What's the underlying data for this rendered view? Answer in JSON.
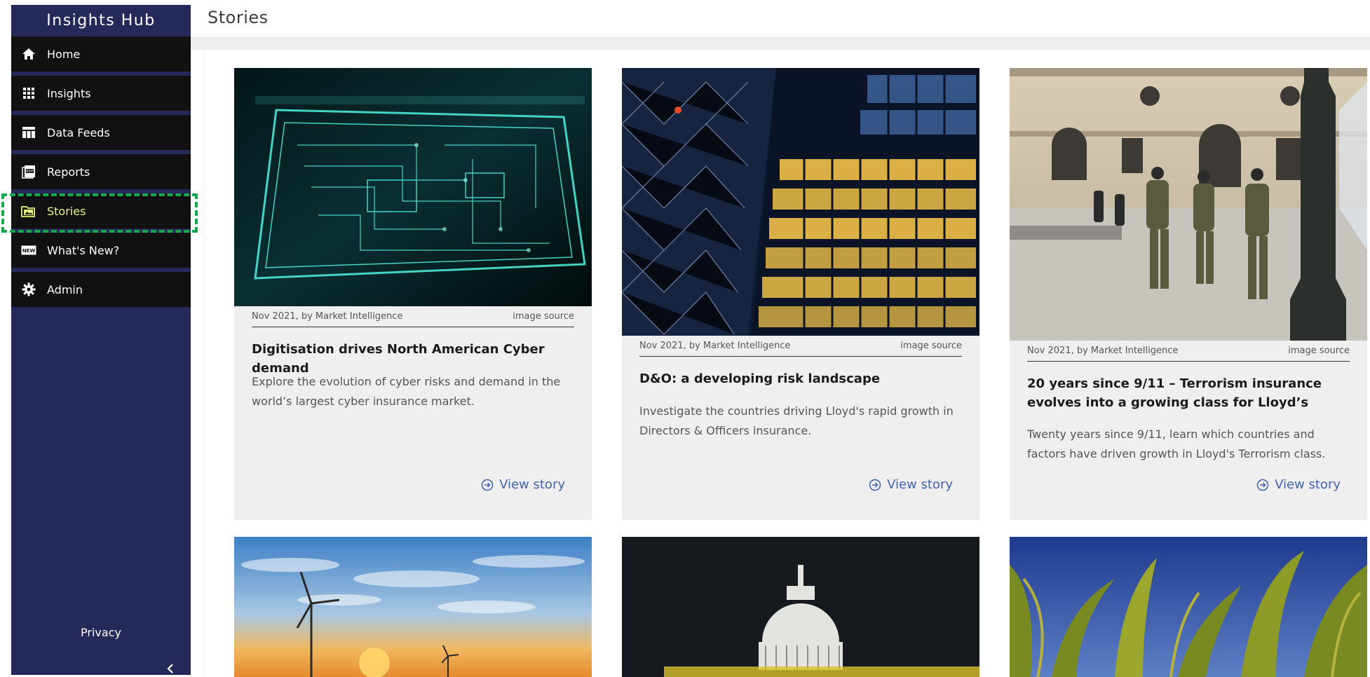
{
  "app": {
    "title": "Insights Hub"
  },
  "page": {
    "title": "Stories"
  },
  "sidebar": {
    "items": [
      {
        "label": "Home",
        "icon": "home-icon"
      },
      {
        "label": "Insights",
        "icon": "grid-icon"
      },
      {
        "label": "Data Feeds",
        "icon": "table-icon"
      },
      {
        "label": "Reports",
        "icon": "pdf-icon"
      },
      {
        "label": "Stories",
        "icon": "stories-icon",
        "active": true
      },
      {
        "label": "What's New?",
        "icon": "new-badge-icon"
      },
      {
        "label": "Admin",
        "icon": "gear-icon"
      }
    ],
    "privacy_label": "Privacy",
    "collapse_icon": "chevron-left-icon"
  },
  "stories": [
    {
      "meta": "Nov 2021, by Market Intelligence",
      "image_source_label": "image source",
      "title": "Digitisation drives North American Cyber demand",
      "description": "Explore the evolution of cyber risks and demand in the world’s largest cyber insurance market.",
      "view_label": "View story"
    },
    {
      "meta": "Nov 2021, by Market Intelligence",
      "image_source_label": "image source",
      "title": "D&O: a developing risk landscape",
      "description": "Investigate the countries driving Lloyd's rapid growth in Directors & Officers insurance.",
      "view_label": "View story"
    },
    {
      "meta": "Nov 2021, by Market Intelligence",
      "image_source_label": "image source",
      "title": "20 years since 9/11 – Terrorism insurance evolves into a growing class for Lloyd’s",
      "description": "Twenty years since 9/11, learn which countries and factors have driven growth in Lloyd's Terrorism class.",
      "view_label": "View story"
    }
  ],
  "colors": {
    "sidebar_bg": "#24295a",
    "nav_bg": "#111111",
    "active_text": "#e9f27b",
    "active_outline": "#18a94a",
    "link": "#3f63b0",
    "card_bg": "#efefef"
  }
}
